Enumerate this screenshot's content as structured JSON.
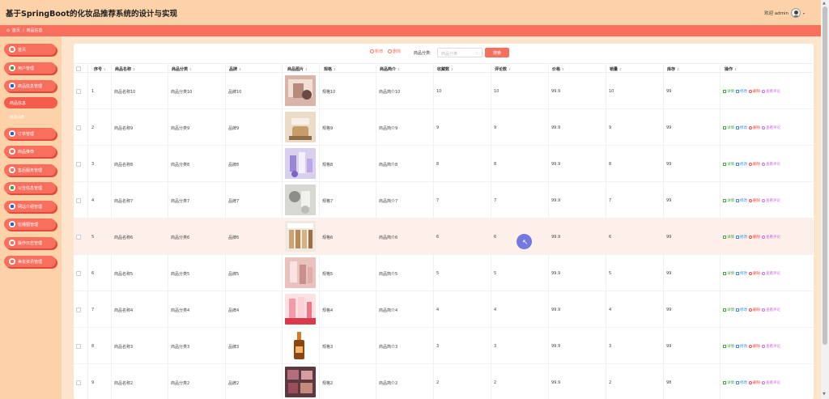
{
  "header": {
    "title": "基于SpringBoot的化妆品推荐系统的设计与实现",
    "welcome": "欢迎 admin"
  },
  "breadcrumb": {
    "home": "首页",
    "separator": "/",
    "current": "商品信息"
  },
  "sidebar": {
    "items": [
      {
        "label": "首页",
        "icon": "home-icon"
      },
      {
        "label": "用户管理",
        "icon": "user-icon"
      },
      {
        "label": "商品信息管理",
        "icon": "product-icon",
        "active": true
      },
      {
        "label": "商品信息",
        "icon": ""
      },
      {
        "label": "商品分类",
        "icon": ""
      },
      {
        "label": "订单管理",
        "icon": "order-icon"
      },
      {
        "label": "商品推荐",
        "icon": "recommend-icon"
      },
      {
        "label": "售后服务管理",
        "icon": "service-icon"
      },
      {
        "label": "公告信息管理",
        "icon": "notice-icon"
      },
      {
        "label": "网站介绍管理",
        "icon": "site-icon"
      },
      {
        "label": "轮播图管理",
        "icon": "carousel-icon"
      },
      {
        "label": "操作日志管理",
        "icon": "log-icon"
      },
      {
        "label": "美妆资讯管理",
        "icon": "news-icon"
      }
    ]
  },
  "toolbar": {
    "add_label": "新增",
    "delete_label": "删除",
    "category_label": "商品分类:",
    "category_placeholder": "商品分类",
    "search_label": "搜索"
  },
  "table": {
    "columns": [
      "序号",
      "商品名称",
      "商品分类",
      "品牌",
      "商品图片",
      "规格",
      "商品简介",
      "收藏数",
      "评论数",
      "价格",
      "销量",
      "库存",
      "操作"
    ],
    "rows": [
      {
        "index": "1",
        "name": "商品名称10",
        "category": "商品分类10",
        "brand": "品牌10",
        "spec": "规格10",
        "intro": "商品简介10",
        "favorites": "10",
        "comments": "10",
        "price": "99.9",
        "sales": "10",
        "stock": "99"
      },
      {
        "index": "2",
        "name": "商品名称9",
        "category": "商品分类9",
        "brand": "品牌9",
        "spec": "规格9",
        "intro": "商品简介9",
        "favorites": "9",
        "comments": "9",
        "price": "99.9",
        "sales": "9",
        "stock": "99"
      },
      {
        "index": "3",
        "name": "商品名称8",
        "category": "商品分类8",
        "brand": "品牌8",
        "spec": "规格8",
        "intro": "商品简介8",
        "favorites": "8",
        "comments": "8",
        "price": "99.9",
        "sales": "8",
        "stock": "99"
      },
      {
        "index": "4",
        "name": "商品名称7",
        "category": "商品分类7",
        "brand": "品牌7",
        "spec": "规格7",
        "intro": "商品简介7",
        "favorites": "7",
        "comments": "7",
        "price": "99.9",
        "sales": "7",
        "stock": "99"
      },
      {
        "index": "5",
        "name": "商品名称6",
        "category": "商品分类6",
        "brand": "品牌6",
        "spec": "规格6",
        "intro": "商品简介6",
        "favorites": "6",
        "comments": "6",
        "price": "99.9",
        "sales": "6",
        "stock": "99"
      },
      {
        "index": "6",
        "name": "商品名称5",
        "category": "商品分类5",
        "brand": "品牌5",
        "spec": "规格5",
        "intro": "商品简介5",
        "favorites": "5",
        "comments": "5",
        "price": "99.9",
        "sales": "5",
        "stock": "99"
      },
      {
        "index": "7",
        "name": "商品名称4",
        "category": "商品分类4",
        "brand": "品牌4",
        "spec": "规格4",
        "intro": "商品简介4",
        "favorites": "4",
        "comments": "4",
        "price": "99.9",
        "sales": "4",
        "stock": "99"
      },
      {
        "index": "8",
        "name": "商品名称3",
        "category": "商品分类3",
        "brand": "品牌3",
        "spec": "规格3",
        "intro": "商品简介3",
        "favorites": "3",
        "comments": "3",
        "price": "99.9",
        "sales": "3",
        "stock": "99"
      },
      {
        "index": "9",
        "name": "商品名称2",
        "category": "商品分类2",
        "brand": "品牌2",
        "spec": "规格2",
        "intro": "商品简介2",
        "favorites": "2",
        "comments": "2",
        "price": "99.9",
        "sales": "2",
        "stock": "98"
      }
    ],
    "actions": {
      "detail": "详情",
      "edit": "修改",
      "delete": "删除",
      "view_comments": "查看评论"
    }
  }
}
